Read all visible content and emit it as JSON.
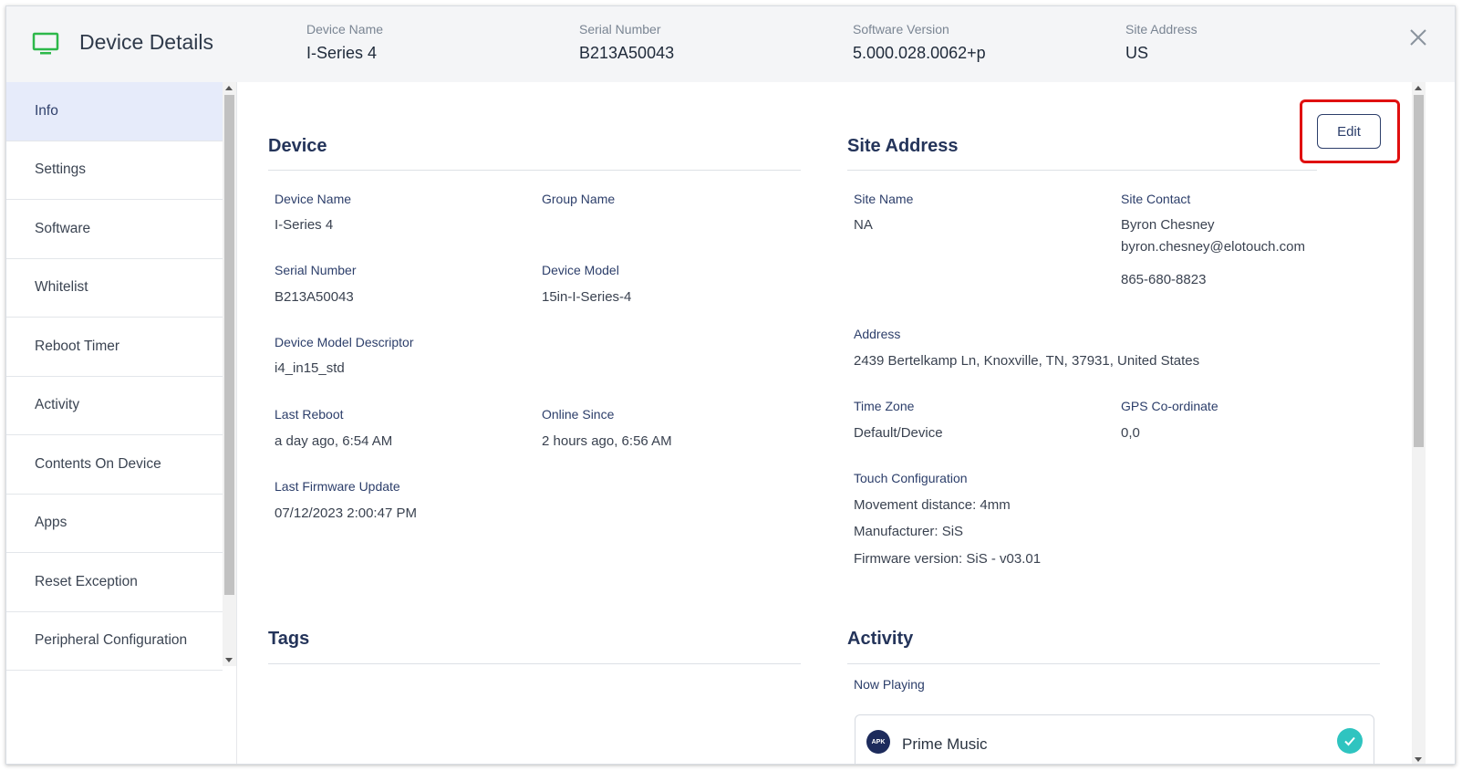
{
  "header": {
    "title": "Device Details",
    "fields": [
      {
        "label": "Device Name",
        "value": "I-Series 4"
      },
      {
        "label": "Serial Number",
        "value": "B213A50043"
      },
      {
        "label": "Software Version",
        "value": "5.000.028.0062+p"
      },
      {
        "label": "Site Address",
        "value": "US"
      }
    ],
    "icon": "monitor-icon",
    "close_icon": "close-icon"
  },
  "sidebar": {
    "items": [
      {
        "label": "Info",
        "active": true
      },
      {
        "label": "Settings"
      },
      {
        "label": "Software"
      },
      {
        "label": "Whitelist"
      },
      {
        "label": "Reboot Timer"
      },
      {
        "label": "Activity"
      },
      {
        "label": "Contents On Device"
      },
      {
        "label": "Apps"
      },
      {
        "label": "Reset Exception"
      },
      {
        "label": "Peripheral Configuration"
      }
    ]
  },
  "device": {
    "title": "Device",
    "device_name_label": "Device Name",
    "device_name": "I-Series 4",
    "group_name_label": "Group Name",
    "group_name": "",
    "serial_number_label": "Serial Number",
    "serial_number": "B213A50043",
    "device_model_label": "Device Model",
    "device_model": "15in-I-Series-4",
    "model_descriptor_label": "Device Model Descriptor",
    "model_descriptor": "i4_in15_std",
    "last_reboot_label": "Last Reboot",
    "last_reboot": "a day ago, 6:54 AM",
    "online_since_label": "Online Since",
    "online_since": "2 hours ago, 6:56 AM",
    "last_firmware_label": "Last Firmware Update",
    "last_firmware": "07/12/2023 2:00:47 PM"
  },
  "site": {
    "title": "Site Address",
    "edit_label": "Edit",
    "site_name_label": "Site Name",
    "site_name": "NA",
    "site_contact_label": "Site Contact",
    "contact_name": "Byron Chesney",
    "contact_email": "byron.chesney@elotouch.com",
    "contact_phone": "865-680-8823",
    "address_label": "Address",
    "address": "2439 Bertelkamp Ln, Knoxville, TN, 37931, United States",
    "time_zone_label": "Time Zone",
    "time_zone": "Default/Device",
    "gps_label": "GPS Co-ordinate",
    "gps": "0,0",
    "touch_label": "Touch Configuration",
    "touch_movement": "Movement distance: 4mm",
    "touch_manufacturer": "Manufacturer: SiS",
    "touch_firmware": "Firmware version: SiS - v03.01"
  },
  "tags": {
    "title": "Tags"
  },
  "activity": {
    "title": "Activity",
    "now_playing_label": "Now Playing",
    "app_badge": "APK",
    "app_name": "Prime Music",
    "status_color": "#2fc4c0"
  },
  "colors": {
    "accent": "#24345a",
    "active_nav_bg": "#e6ebfa",
    "highlight": "#e01010",
    "monitor_icon": "#2db84a"
  }
}
